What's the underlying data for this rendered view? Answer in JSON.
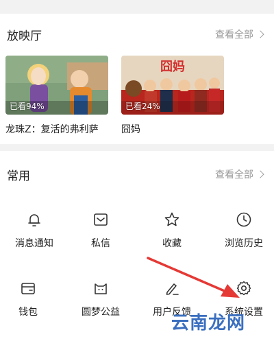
{
  "theater": {
    "title": "放映厅",
    "more_label": "查看全部",
    "videos": [
      {
        "title": "龙珠Z：复活的弗利萨",
        "progress": "已看94%"
      },
      {
        "title": "囧妈",
        "progress": "已看24%"
      }
    ]
  },
  "common": {
    "title": "常用",
    "more_label": "查看全部",
    "items": [
      {
        "label": "消息通知",
        "icon": "bell-icon"
      },
      {
        "label": "私信",
        "icon": "message-icon"
      },
      {
        "label": "收藏",
        "icon": "star-icon"
      },
      {
        "label": "浏览历史",
        "icon": "clock-icon"
      },
      {
        "label": "钱包",
        "icon": "wallet-icon"
      },
      {
        "label": "圆梦公益",
        "icon": "cat-face-icon"
      },
      {
        "label": "用户反馈",
        "icon": "pen-icon"
      },
      {
        "label": "系统设置",
        "icon": "gear-icon"
      }
    ]
  },
  "annotation": {
    "arrow_color": "#e53935"
  },
  "watermark": "云南龙网"
}
